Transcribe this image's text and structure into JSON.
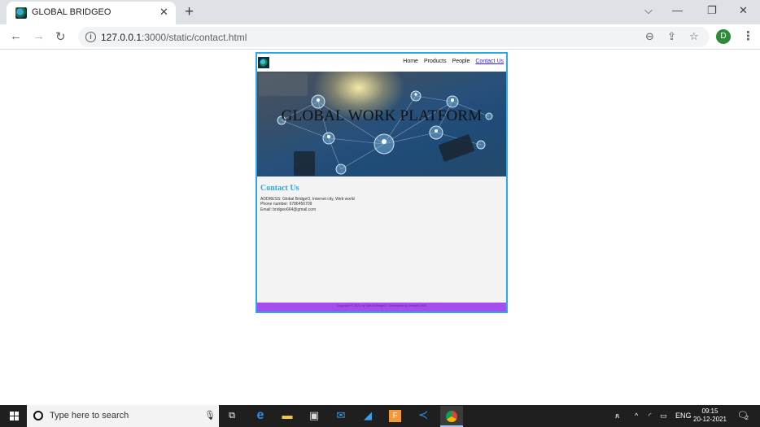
{
  "browser": {
    "tab_title": "GLOBAL BRIDGEO",
    "tab_close": "✕",
    "new_tab": "+",
    "url_host": "127.0.0.1",
    "url_rest": ":3000/static/contact.html",
    "profile_initial": "D",
    "window_controls": {
      "dropdown": "⌵",
      "minimize": "—",
      "restore": "❐",
      "close": "✕"
    }
  },
  "site": {
    "nav": [
      "Home",
      "Products",
      "People",
      "Contact Us"
    ],
    "hero_title": "GLOBAL WORK PLATFORM",
    "contact_heading": "Contact Us",
    "address": "ADDRESS: Global BridgeO, Internet city, Web world",
    "phone": "Phone number: 6786456709",
    "email": "Email: bridgeo664@gmail.com",
    "footer": "Copyright © 2021 by Global BridgeO. Developed by Deepthi GSN"
  },
  "taskbar": {
    "search_placeholder": "Type here to search",
    "tray_lang": "ENG",
    "time": "09:15",
    "date": "20-12-2021",
    "notification_count": "2"
  },
  "colors": {
    "site_border": "#2ea7e6",
    "heading": "#2ea7e6",
    "footer_bg": "#a64df0",
    "active_nav": "#3a1fd6"
  }
}
